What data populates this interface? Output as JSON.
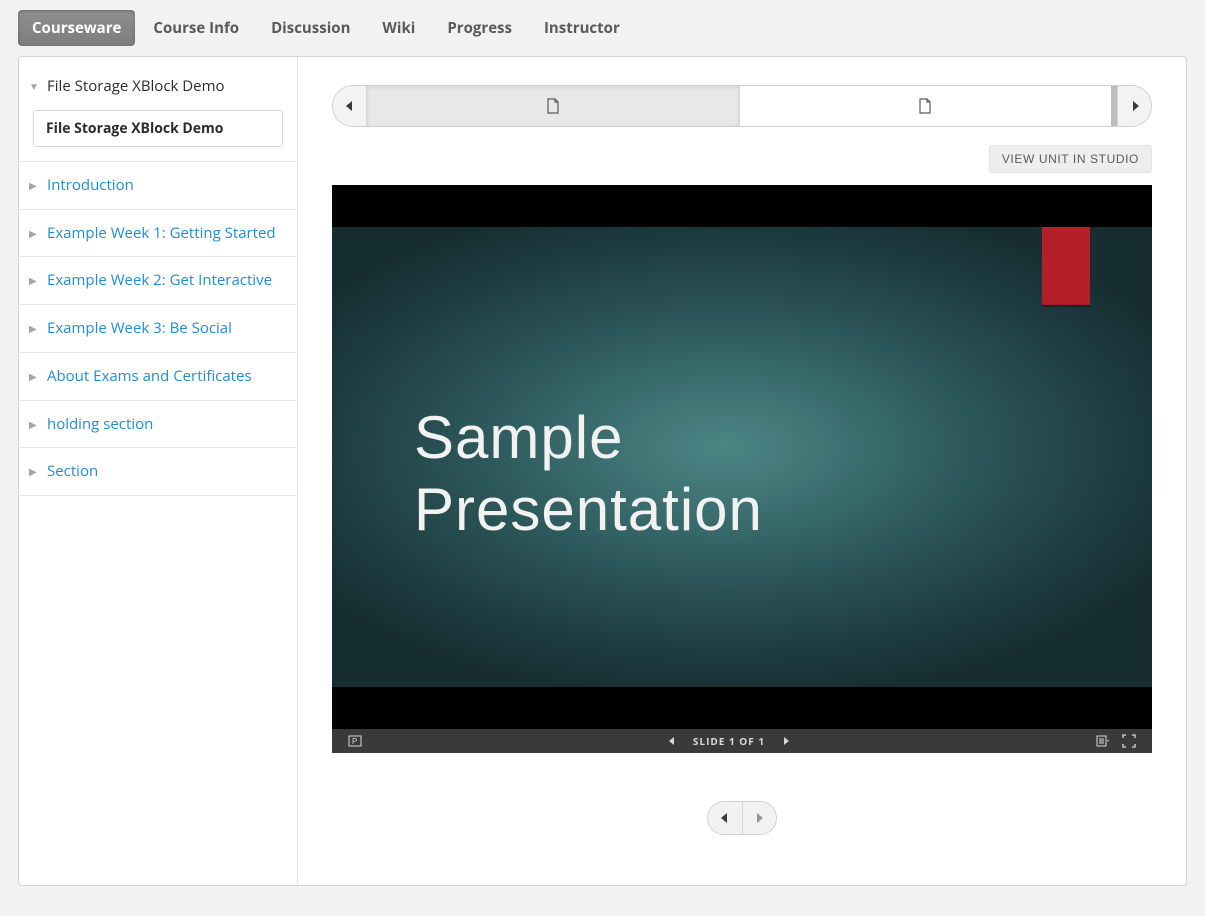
{
  "nav": {
    "tabs": [
      {
        "label": "Courseware",
        "active": true
      },
      {
        "label": "Course Info",
        "active": false
      },
      {
        "label": "Discussion",
        "active": false
      },
      {
        "label": "Wiki",
        "active": false
      },
      {
        "label": "Progress",
        "active": false
      },
      {
        "label": "Instructor",
        "active": false
      }
    ]
  },
  "sidebar": {
    "sections": [
      {
        "label": "File Storage XBlock Demo",
        "expanded": true,
        "subitems": [
          "File Storage XBlock Demo"
        ]
      },
      {
        "label": "Introduction",
        "expanded": false
      },
      {
        "label": "Example Week 1: Getting Started",
        "expanded": false
      },
      {
        "label": "Example Week 2: Get Interactive",
        "expanded": false
      },
      {
        "label": "Example Week 3: Be Social",
        "expanded": false
      },
      {
        "label": "About Exams and Certificates",
        "expanded": false
      },
      {
        "label": "holding section",
        "expanded": false
      },
      {
        "label": "Section",
        "expanded": false
      }
    ]
  },
  "sequence": {
    "tabs": [
      {
        "icon": "document",
        "active": true
      },
      {
        "icon": "document",
        "active": false
      }
    ]
  },
  "toolbar": {
    "view_in_studio": "VIEW UNIT IN STUDIO"
  },
  "slide": {
    "title_line1": "Sample",
    "title_line2": "Presentation",
    "controlbar_label": "SLIDE 1 OF 1"
  }
}
